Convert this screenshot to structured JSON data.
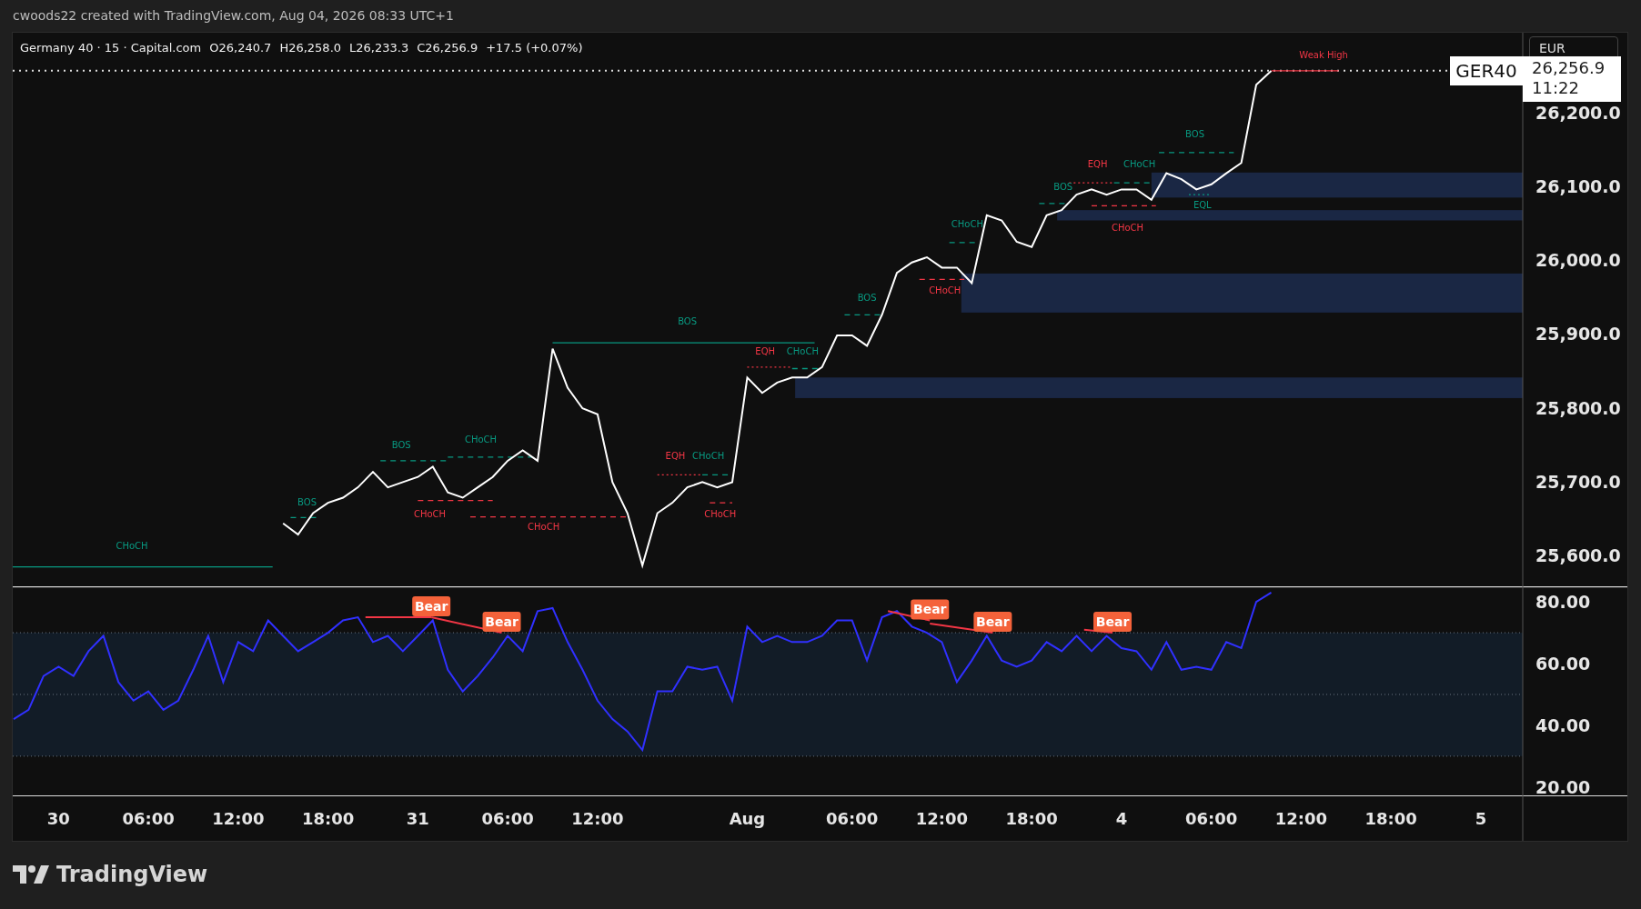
{
  "attribution": "cwoods22 created with TradingView.com, Aug 04, 2026 08:33 UTC+1",
  "legend": {
    "symbol": "Germany 40 · 15 · Capital.com",
    "values": [
      "O26,240.7",
      "H26,258.0",
      "L26,233.3",
      "C26,256.9"
    ],
    "change": "+17.5 (+0.07%)"
  },
  "currency": "EUR",
  "last_price": {
    "symbol": "GER40",
    "value": "26,256.9",
    "countdown": "11:22"
  },
  "price_pane": {
    "chart_data": {
      "type": "line",
      "ylim": [
        25556.5,
        26308.6
      ],
      "series": [
        {
          "color": "#ffffff",
          "values": [
            25643,
            25628,
            25657,
            25671,
            25678,
            25692,
            25713,
            25692,
            25699,
            25706,
            25720,
            25685,
            25678,
            25692,
            25706,
            25728,
            25742,
            25728,
            25880,
            25827,
            25799,
            25791,
            25699,
            25657,
            25586,
            25657,
            25671,
            25692,
            25699,
            25692,
            25699,
            25841,
            25820,
            25834,
            25841,
            25841,
            25855,
            25898,
            25898,
            25884,
            25926,
            25983,
            25997,
            26004,
            25990,
            25990,
            25969,
            26061,
            26054,
            26025,
            26018,
            26061,
            26068,
            26089,
            26096,
            26089,
            26096,
            26096,
            26082,
            26118,
            26110,
            26096,
            26103,
            26118,
            26132,
            26238,
            26257
          ]
        }
      ],
      "yticks": [
        {
          "value": 25600,
          "label": "25,600.0"
        },
        {
          "value": 25700,
          "label": "25,700.0"
        },
        {
          "value": 25800,
          "label": "25,800.0"
        },
        {
          "value": 25900,
          "label": "25,900.0"
        },
        {
          "value": 26000,
          "label": "26,000.0"
        },
        {
          "value": 26100,
          "label": "26,100.0"
        },
        {
          "value": 26200,
          "label": "26,200.0"
        }
      ]
    },
    "structure_labels": [
      {
        "text": "CHoCH",
        "color": "#089981"
      },
      {
        "text": "BOS",
        "color": "#089981"
      },
      {
        "text": "BOS",
        "color": "#089981"
      },
      {
        "text": "CHoCH",
        "color": "#089981"
      },
      {
        "text": "CHoCH",
        "color": "#f23645"
      },
      {
        "text": "CHoCH",
        "color": "#f23645"
      },
      {
        "text": "BOS",
        "color": "#089981"
      },
      {
        "text": "EQH",
        "color": "#f23645"
      },
      {
        "text": "CHoCH",
        "color": "#089981"
      },
      {
        "text": "CHoCH",
        "color": "#f23645"
      },
      {
        "text": "EQH",
        "color": "#f23645"
      },
      {
        "text": "CHoCH",
        "color": "#089981"
      },
      {
        "text": "BOS",
        "color": "#089981"
      },
      {
        "text": "CHoCH",
        "color": "#089981"
      },
      {
        "text": "CHoCH",
        "color": "#f23645"
      },
      {
        "text": "BOS",
        "color": "#089981"
      },
      {
        "text": "EQH",
        "color": "#f23645"
      },
      {
        "text": "CHoCH",
        "color": "#089981"
      },
      {
        "text": "CHoCH",
        "color": "#f23645"
      },
      {
        "text": "EQL",
        "color": "#089981"
      },
      {
        "text": "BOS",
        "color": "#089981"
      },
      {
        "text": "Weak High",
        "color": "#f23645"
      }
    ]
  },
  "rsi_pane": {
    "chart_data": {
      "type": "line",
      "ylim": [
        17,
        84.75
      ],
      "series": [
        {
          "color": "#3030ff",
          "values": [
            42,
            45,
            56,
            59,
            56,
            64,
            69,
            54,
            48,
            51,
            45,
            48,
            58,
            69,
            54,
            67,
            64,
            74,
            69,
            64,
            67,
            70,
            74,
            75,
            67,
            69,
            64,
            69,
            74,
            58,
            51,
            56,
            62,
            69,
            64,
            77,
            78,
            67,
            58,
            48,
            42,
            38,
            32,
            51,
            51,
            59,
            58,
            59,
            48,
            72,
            67,
            69,
            67,
            67,
            69,
            74,
            74,
            61,
            75,
            77,
            72,
            70,
            67,
            54,
            61,
            69,
            61,
            59,
            61,
            67,
            64,
            69,
            64,
            69,
            65,
            64,
            58,
            67,
            58,
            59,
            58,
            67,
            65,
            80,
            83
          ]
        }
      ],
      "yticks": [
        {
          "value": 20,
          "label": "20.00"
        },
        {
          "value": 40,
          "label": "40.00"
        },
        {
          "value": 60,
          "label": "60.00"
        },
        {
          "value": 80,
          "label": "80.00"
        }
      ]
    },
    "signals": [
      "Bear",
      "Bear",
      "Bear",
      "Bear",
      "Bear"
    ]
  },
  "time_axis": [
    "30",
    "06:00",
    "12:00",
    "18:00",
    "31",
    "06:00",
    "12:00",
    "Aug",
    "06:00",
    "12:00",
    "18:00",
    "4",
    "06:00",
    "12:00",
    "18:00",
    "5"
  ],
  "logo": "TradingView"
}
